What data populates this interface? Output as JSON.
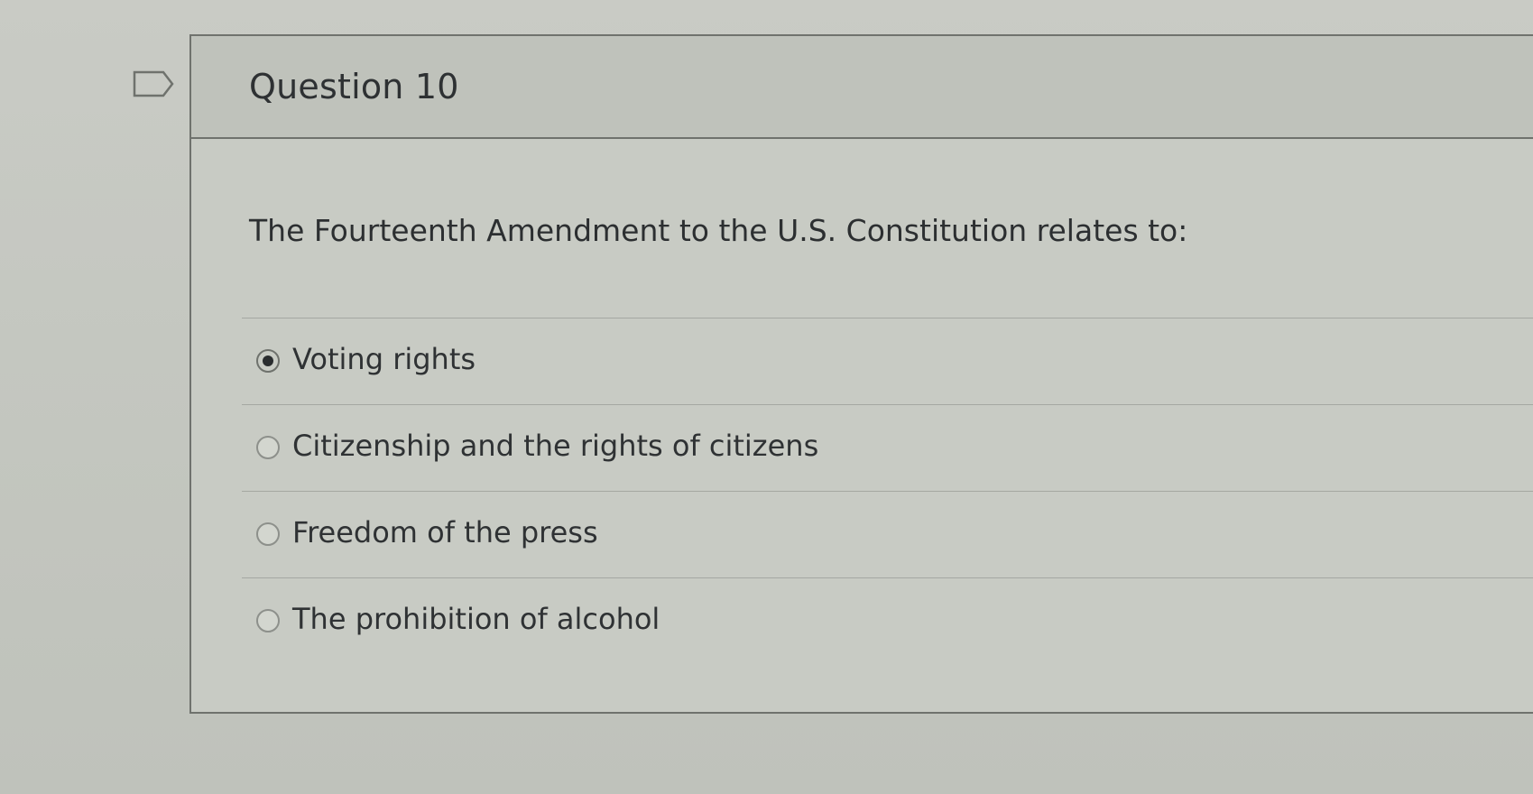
{
  "question": {
    "title": "Question 10",
    "prompt": "The Fourteenth Amendment to the U.S. Constitution relates to:",
    "options": [
      {
        "label": "Voting rights",
        "selected": true
      },
      {
        "label": "Citizenship and the rights of citizens",
        "selected": false
      },
      {
        "label": "Freedom of the press",
        "selected": false
      },
      {
        "label": "The prohibition of alcohol",
        "selected": false
      }
    ]
  },
  "icons": {
    "flag": "flag-icon",
    "radio_selected": "radio-selected-icon",
    "radio_unselected": "radio-unselected-icon"
  },
  "colors": {
    "text": "#2e3133",
    "border": "#6f726d",
    "background": "#c8cbc4",
    "radio_fill": "#2a2d2f"
  }
}
